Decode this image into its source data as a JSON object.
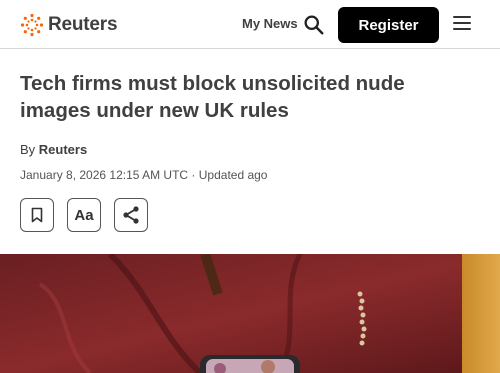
{
  "header": {
    "brand": "Reuters",
    "my_news": "My News",
    "register_label": "Register",
    "brand_color": "#fa6400"
  },
  "article": {
    "headline": "Tech firms must block unsolicited nude images under new UK rules",
    "byline_prefix": "By",
    "byline_author": "Reuters",
    "dateline": "January 8, 2026 12:15 AM UTC · Updated ago"
  },
  "actions": {
    "font_size_label": "Aa"
  }
}
